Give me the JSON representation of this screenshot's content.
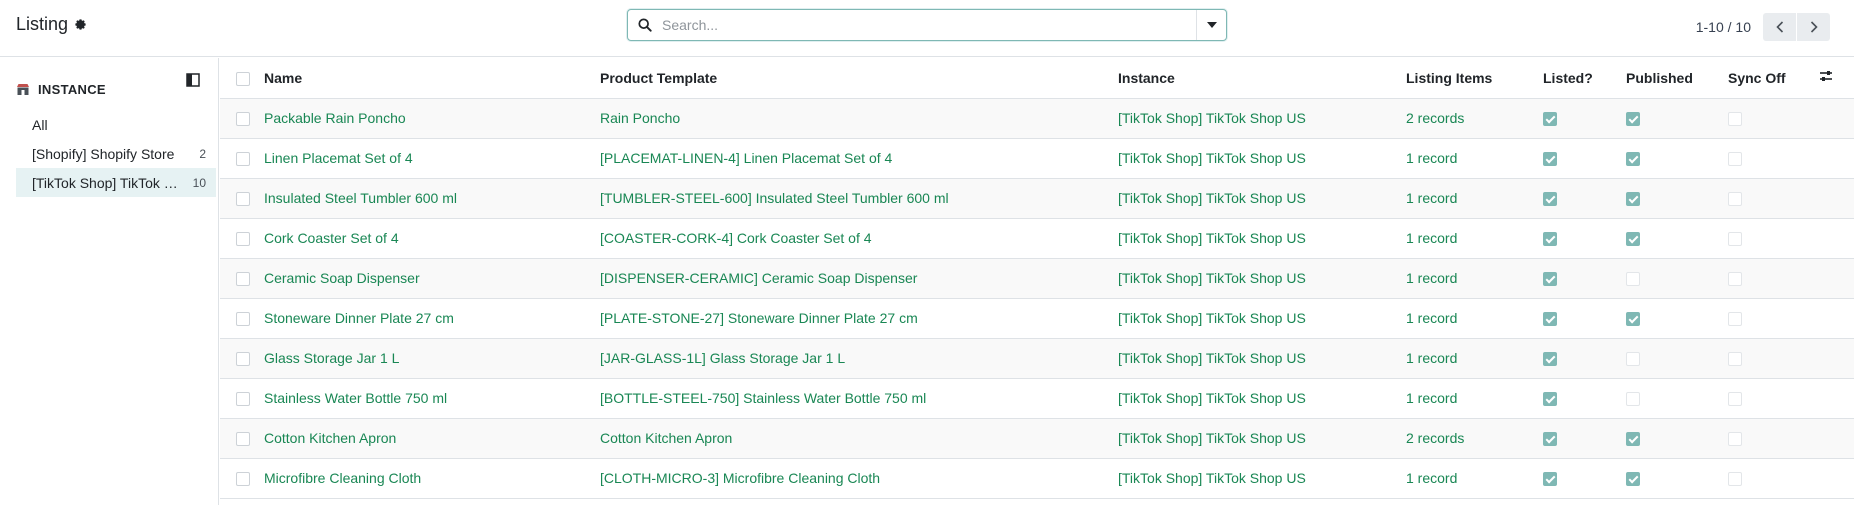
{
  "header": {
    "title": "Listing",
    "search_placeholder": "Search...",
    "pager": "1-10 / 10"
  },
  "sidebar": {
    "section_title": "INSTANCE",
    "items": [
      {
        "label": "All",
        "count": ""
      },
      {
        "label": "[Shopify] Shopify Store",
        "count": "2"
      },
      {
        "label": "[TikTok Shop] TikTok Shop US",
        "count": "10"
      }
    ]
  },
  "table": {
    "columns": {
      "name": "Name",
      "template": "Product Template",
      "instance": "Instance",
      "items": "Listing Items",
      "listed": "Listed?",
      "published": "Published",
      "sync_off": "Sync Off"
    },
    "rows": [
      {
        "name": "Packable Rain Poncho",
        "template": "Rain Poncho",
        "instance": "[TikTok Shop] TikTok Shop US",
        "items": "2 records",
        "listed": true,
        "published": true,
        "sync_off": false
      },
      {
        "name": "Linen Placemat Set of 4",
        "template": "[PLACEMAT-LINEN-4] Linen Placemat Set of 4",
        "instance": "[TikTok Shop] TikTok Shop US",
        "items": "1 record",
        "listed": true,
        "published": true,
        "sync_off": false
      },
      {
        "name": "Insulated Steel Tumbler 600 ml",
        "template": "[TUMBLER-STEEL-600] Insulated Steel Tumbler 600 ml",
        "instance": "[TikTok Shop] TikTok Shop US",
        "items": "1 record",
        "listed": true,
        "published": true,
        "sync_off": false
      },
      {
        "name": "Cork Coaster Set of 4",
        "template": "[COASTER-CORK-4] Cork Coaster Set of 4",
        "instance": "[TikTok Shop] TikTok Shop US",
        "items": "1 record",
        "listed": true,
        "published": true,
        "sync_off": false
      },
      {
        "name": "Ceramic Soap Dispenser",
        "template": "[DISPENSER-CERAMIC] Ceramic Soap Dispenser",
        "instance": "[TikTok Shop] TikTok Shop US",
        "items": "1 record",
        "listed": true,
        "published": false,
        "sync_off": false
      },
      {
        "name": "Stoneware Dinner Plate 27 cm",
        "template": "[PLATE-STONE-27] Stoneware Dinner Plate 27 cm",
        "instance": "[TikTok Shop] TikTok Shop US",
        "items": "1 record",
        "listed": true,
        "published": true,
        "sync_off": false
      },
      {
        "name": "Glass Storage Jar 1 L",
        "template": "[JAR-GLASS-1L] Glass Storage Jar 1 L",
        "instance": "[TikTok Shop] TikTok Shop US",
        "items": "1 record",
        "listed": true,
        "published": false,
        "sync_off": false
      },
      {
        "name": "Stainless Water Bottle 750 ml",
        "template": "[BOTTLE-STEEL-750] Stainless Water Bottle 750 ml",
        "instance": "[TikTok Shop] TikTok Shop US",
        "items": "1 record",
        "listed": true,
        "published": false,
        "sync_off": false
      },
      {
        "name": "Cotton Kitchen Apron",
        "template": "Cotton Kitchen Apron",
        "instance": "[TikTok Shop] TikTok Shop US",
        "items": "2 records",
        "listed": true,
        "published": true,
        "sync_off": false
      },
      {
        "name": "Microfibre Cleaning Cloth",
        "template": "[CLOTH-MICRO-3] Microfibre Cleaning Cloth",
        "instance": "[TikTok Shop] TikTok Shop US",
        "items": "1 record",
        "listed": true,
        "published": true,
        "sync_off": false
      }
    ]
  },
  "colors": {
    "link": "#198754",
    "check_on": "#7fb8b4",
    "active_bg": "#e6f2f3"
  }
}
